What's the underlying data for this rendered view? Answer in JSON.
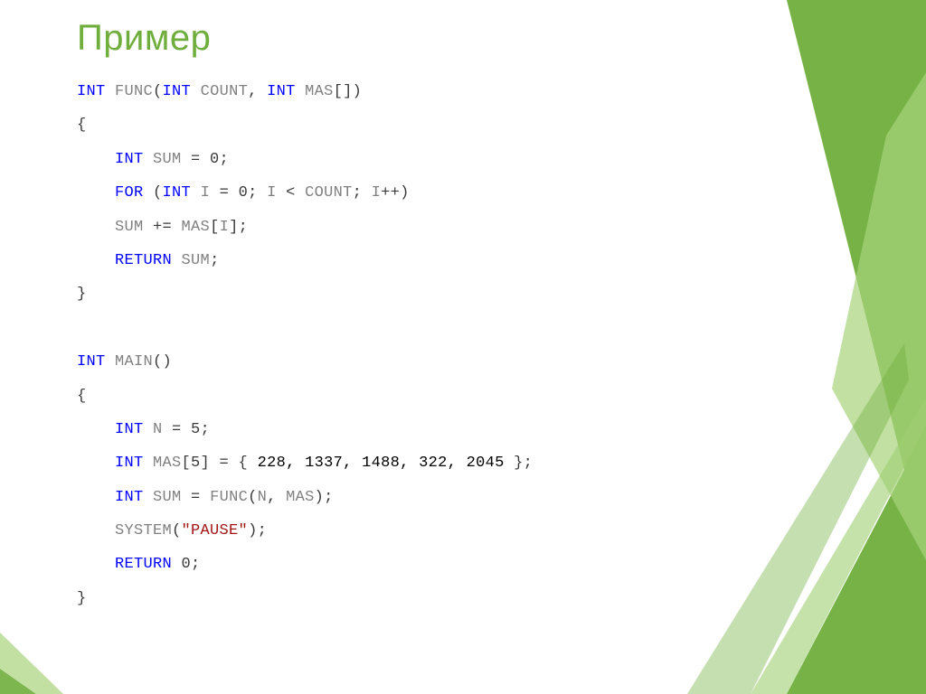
{
  "slide": {
    "title": "Пример"
  },
  "code": {
    "l1": {
      "kw1": "int",
      "fn": " func",
      "p1": "(",
      "kw2": "int",
      "arg1": " count",
      "c": ", ",
      "kw3": "int",
      "arg2": " mas",
      "br": "[])"
    },
    "l2": "{",
    "l3": {
      "indent": "    ",
      "kw": "int",
      "name": " sum",
      "rest": " = 0;"
    },
    "l4": {
      "indent": "    ",
      "kw1": "for",
      "p": " (",
      "kw2": "int",
      "var": " i",
      "a": " = 0; ",
      "var2": "i",
      "lt": " < ",
      "cnt": "count",
      "sc": "; ",
      "var3": "i",
      "pp": "++)"
    },
    "l5": {
      "indent": "    ",
      "sum": "sum",
      "pe": " += ",
      "mas": "mas",
      "br": "[",
      "i": "i",
      "br2": "];"
    },
    "l6": {
      "indent": "    ",
      "kw": "return",
      "sp": " ",
      "sum": "sum",
      "sc": ";"
    },
    "l7": "}",
    "blank": " ",
    "l9": {
      "kw1": "int",
      "fn": " main",
      "p": "()"
    },
    "l10": "{",
    "l11": {
      "indent": "    ",
      "kw": "int",
      "n": " N",
      "rest": " = 5;"
    },
    "l12": {
      "indent": "    ",
      "kw": "int",
      "mas": " mas",
      "open": "[5] = { ",
      "v": "228, 1337, 1488, 322, 2045",
      "close": " };"
    },
    "l13": {
      "indent": "    ",
      "kw": "int",
      "sum": " sum",
      "eq": " = ",
      "fn": "func",
      "p": "(",
      "n": "N",
      "c": ", ",
      "mas": "mas",
      "cp": ");"
    },
    "l14": {
      "indent": "    ",
      "sys": "system",
      "p": "(",
      "str": "\"pause\"",
      "cp": ");"
    },
    "l15": {
      "indent": "    ",
      "kw": "return",
      "sp": " 0;"
    },
    "l16": "}"
  }
}
